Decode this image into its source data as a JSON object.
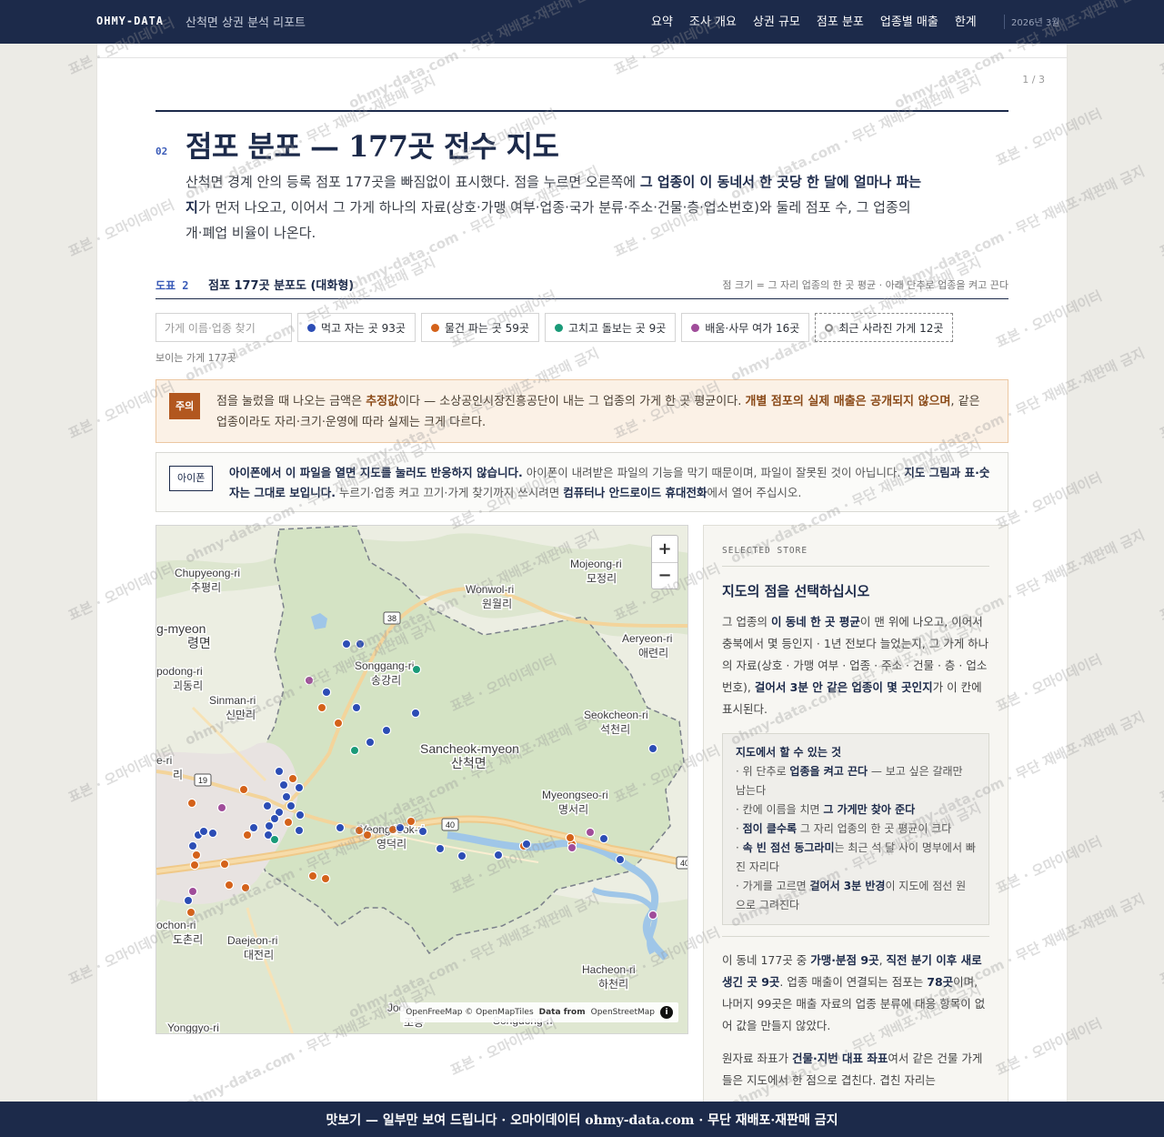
{
  "nav": {
    "brand": "OHMY-DATA",
    "report_title": "산척면 상권 분석 리포트",
    "links": [
      "요약",
      "조사 개요",
      "상권 규모",
      "점포 분포",
      "업종별 매출",
      "한계"
    ],
    "date": "2026년 3월"
  },
  "page_label": "1 / 3",
  "section": {
    "number": "02",
    "title": "점포 분포 — 177곳 전수 지도",
    "lede_1": "산척면 경계 안의 등록 점포 177곳을 빠짐없이 표시했다. 점을 누르면 오른쪽에 ",
    "lede_bold": "그 업종이 이 동네서 한 곳당 한 달에 얼마나 파는지",
    "lede_2": "가 먼저 나오고, 이어서 그 가게 하나의 자료(상호·가맹 여부·업종·국가 분류·주소·건물·층·업소번호)와 둘레 점포 수, 그 업종의 개·폐업 비율이 나온다."
  },
  "figure": {
    "label": "도표 2",
    "title": "점포 177곳 분포도 (대화형)",
    "note": "점 크기 = 그 자리 업종의 한 곳 평균 · 아래 단추로 업종을 켜고 끈다"
  },
  "search": {
    "placeholder": "가게 이름·업종 찾기"
  },
  "filters": [
    {
      "label": "먹고 자는 곳 93곳",
      "color": "#2c4db5"
    },
    {
      "label": "물건 파는 곳 59곳",
      "color": "#d4621a"
    },
    {
      "label": "고치고 돌보는 곳 9곳",
      "color": "#1a9a78"
    },
    {
      "label": "배움·사무 여가 16곳",
      "color": "#a04d9a"
    },
    {
      "label": "최근 사라진 가게 12곳",
      "color": "#888888"
    }
  ],
  "visible_count": "보이는 가게 177곳",
  "warning": {
    "tag": "주의",
    "t1": "점을 눌렀을 때 나오는 금액은 ",
    "b1": "추정값",
    "t2": "이다 — 소상공인시장진흥공단이 내는 그 업종의 가게 한 곳 평균이다. ",
    "b2": "개별 점포의 실제 매출은 공개되지 않으며",
    "t3": ", 같은 업종이라도 자리·크기·운영에 따라 실제는 크게 다르다."
  },
  "ios": {
    "tag": "아이폰",
    "b1": "아이폰에서 이 파일을 열면 지도를 눌러도 반응하지 않습니다.",
    "t1": " 아이폰이 내려받은 파일의 기능을 막기 때문이며, 파일이 잘못된 것이 아닙니다. ",
    "b2": "지도 그림과 표·숫자는 그대로 보입니다.",
    "t2": " 누르기·업종 켜고 끄기·가게 찾기까지 쓰시려면 ",
    "b3": "컴퓨터나 안드로이드 휴대전화",
    "t3": "에서 열어 주십시오."
  },
  "map": {
    "zoom_in": "+",
    "zoom_out": "−",
    "attribution_1": "OpenFreeMap © OpenMapTiles",
    "attribution_2": "Data from",
    "attribution_3": "OpenStreetMap",
    "places": [
      {
        "en": "Chupyeong-ri",
        "ko": "추평리"
      },
      {
        "en": "Mojeong-ri",
        "ko": "모정리"
      },
      {
        "en": "Wonwol-ri",
        "ko": "원월리"
      },
      {
        "en": "g-myeon",
        "ko": "령면"
      },
      {
        "en": "Songgang-ri",
        "ko": "송강리"
      },
      {
        "en": "Aeryeon-ri",
        "ko": "애련리"
      },
      {
        "en": "podong-ri",
        "ko": "괴동리"
      },
      {
        "en": "Sinman-ri",
        "ko": "신만리"
      },
      {
        "en": "Seokcheon-ri",
        "ko": "석천리"
      },
      {
        "en": "Sancheok-myeon",
        "ko": "산척면"
      },
      {
        "en": "e-ri",
        "ko": "리"
      },
      {
        "en": "Yeongdeok-ri",
        "ko": "영덕리"
      },
      {
        "en": "Myeongseo-ri",
        "ko": "명서리"
      },
      {
        "en": "ochon-ri",
        "ko": "도촌리"
      },
      {
        "en": "Daejeon-ri",
        "ko": "대전리"
      },
      {
        "en": "Hacheon-ri",
        "ko": "하천리"
      },
      {
        "en": "Yonggyo-ri",
        "ko": ""
      },
      {
        "en": "Jodo",
        "ko": "조동"
      },
      {
        "en": "Songdong-ri",
        "ko": ""
      }
    ],
    "routes": [
      "38",
      "19",
      "40",
      "40"
    ]
  },
  "panel": {
    "kicker": "SELECTED STORE",
    "heading": "지도의 점을 선택하십시오",
    "p1_a": "그 업종의 ",
    "p1_b": "이 동네 한 곳 평균",
    "p1_c": "이 맨 위에 나오고, 이어서 충북에서 몇 등인지 · 1년 전보다 늘었는지, 그 가게 하나의 자료(상호 · 가맹 여부 · 업종 · 주소 · 건물 · 층 · 업소번호), ",
    "p1_d": "걸어서 3분 안 같은 업종이 몇 곳인지",
    "p1_e": "가 이 칸에 표시된다.",
    "box_head": "지도에서 할 수 있는 것",
    "box_1a": "· 위 단추로 ",
    "box_1b": "업종을 켜고 끈다",
    "box_1c": " — 보고 싶은 갈래만 남는다",
    "box_2a": "· 칸에 이름을 치면 ",
    "box_2b": "그 가게만 찾아 준다",
    "box_3a": "· ",
    "box_3b": "점이 클수록",
    "box_3c": " 그 자리 업종의 한 곳 평균이 크다",
    "box_4a": "· ",
    "box_4b": "속 빈 점선 동그라미",
    "box_4c": "는 최근 석 달 사이 명부에서 빠진 자리다",
    "box_5a": "· 가게를 고르면 ",
    "box_5b": "걸어서 3분 반경",
    "box_5c": "이 지도에 점선 원으로 그려진다",
    "p2_a": "이 동네 177곳 중 ",
    "p2_b": "가맹·분점 9곳",
    "p2_c": ", ",
    "p2_d": "직전 분기 이후 새로 생긴 곳 9곳",
    "p2_e": ". 업종 매출이 연결되는 점포는 ",
    "p2_f": "78곳",
    "p2_g": "이며, 나머지 99곳은 매출 자료의 업종 분류에 대응 항목이 없어 값을 만들지 않았다.",
    "p3_a": "원자료 좌표가 ",
    "p3_b": "건물·지번 대표 좌표",
    "p3_c": "여서 같은 건물 가게들은 지도에서 한 점으로 겹친다. 겹친 자리는"
  },
  "watermark": "표본 · 오마이데이터",
  "watermark_2": "ohmy-data.com · 무단 재배포·재판매 금지",
  "banner": "맛보기 — 일부만 보여 드립니다 · 오마이데이터 ohmy-data.com · 무단 재배포·재판매 금지"
}
